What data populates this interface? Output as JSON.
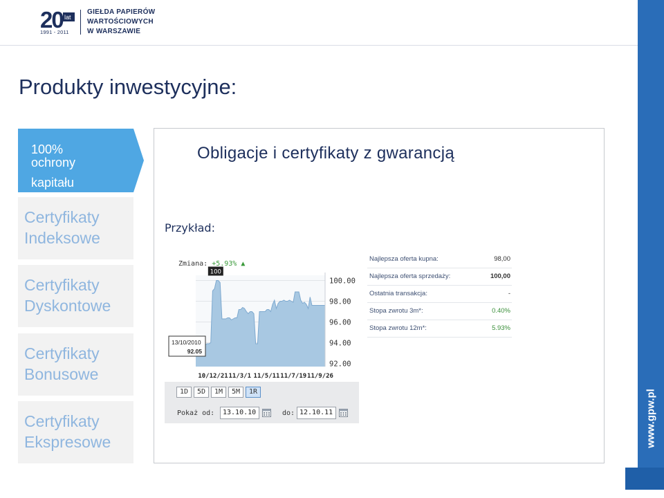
{
  "header": {
    "logo_number": "20",
    "logo_badge": "lat",
    "logo_years": "1991 - 2011",
    "org_line1": "GIEŁDA PAPIERÓW",
    "org_line2": "WARTOŚCIOWYCH",
    "org_line3": "W WARSZAWIE"
  },
  "page_title": "Produkty inwestycyjne:",
  "sidebar": {
    "active": {
      "line1": "100%",
      "line2": "ochrony",
      "line3": "kapitału"
    },
    "items": [
      {
        "line1": "Certyfikaty",
        "line2": "Indeksowe"
      },
      {
        "line1": "Certyfikaty",
        "line2": "Dyskontowe"
      },
      {
        "line1": "Certyfikaty",
        "line2": "Bonusowe"
      },
      {
        "line1": "Certyfikaty",
        "line2": "Ekspresowe"
      }
    ]
  },
  "panel": {
    "title": "Obligacje i certyfikaty z gwarancją",
    "example_label": "Przykład:"
  },
  "chart_data": {
    "type": "area",
    "change_label": "Zmiana:",
    "change_value": "+5.93%",
    "series": [
      {
        "values": [
          93.0,
          93.0,
          93.6,
          93.7,
          93.7,
          93.8,
          93.9,
          93.9,
          94.0,
          99.0,
          99.2,
          100.0,
          100.0,
          99.8,
          96.3,
          96.3,
          96.3,
          96.4,
          96.4,
          96.2,
          96.3,
          96.4,
          96.4,
          97.2,
          97.2,
          97.4,
          97.3,
          97.0,
          96.8,
          97.0,
          97.0,
          96.8,
          93.9,
          93.9,
          97.0,
          97.0,
          97.0,
          97.0,
          97.2,
          97.2,
          97.0,
          97.7,
          98.1,
          97.3,
          97.8,
          98.0,
          98.0,
          98.1,
          98.0,
          98.0,
          98.1,
          98.0,
          97.9,
          98.9,
          98.9,
          98.9,
          98.1,
          97.8,
          97.9,
          97.7,
          97.3,
          98.4,
          97.6,
          97.6,
          97.6,
          97.6,
          97.6,
          97.6,
          97.6,
          97.6
        ]
      }
    ],
    "x_tick_labels": [
      "10/12/21",
      "11/3/1",
      "11/5/11",
      "11/7/19",
      "11/9/26"
    ],
    "y_tick_labels": [
      "100.00",
      "98.00",
      "96.00",
      "94.00",
      "92.00"
    ],
    "ylim": [
      91.7,
      100.5
    ],
    "grid": true,
    "annotations": [
      {
        "label": "100",
        "x_index": 11,
        "y": 100.0
      },
      {
        "date": "13/10/2010",
        "value": "92.05"
      }
    ]
  },
  "controls": {
    "periods": [
      "1D",
      "5D",
      "1M",
      "5M",
      "1R"
    ],
    "active_period": "1R",
    "from_label": "Pokaż od:",
    "from_value": "13.10.10",
    "to_label": "do:",
    "to_value": "12.10.11"
  },
  "offers": [
    {
      "label": "Najlepsza oferta kupna:",
      "value": "98,00"
    },
    {
      "label": "Najlepsza oferta sprzedaży:",
      "value": "100,00"
    },
    {
      "label": "Ostatnia transakcja:",
      "value": "-"
    },
    {
      "label": "Stopa zwrotu 3m*:",
      "value": "0.40%"
    },
    {
      "label": "Stopa zwrotu 12m*:",
      "value": "5.93%"
    }
  ],
  "side_url": "www.gpw.pl",
  "colors": {
    "navy": "#1d2f5c",
    "brand_blue": "#2a6db8",
    "active_tab": "#4fa7e3",
    "inactive_text": "#8fb6df",
    "chart_fill": "#a8c8e2",
    "positive": "#3a9a3a"
  }
}
